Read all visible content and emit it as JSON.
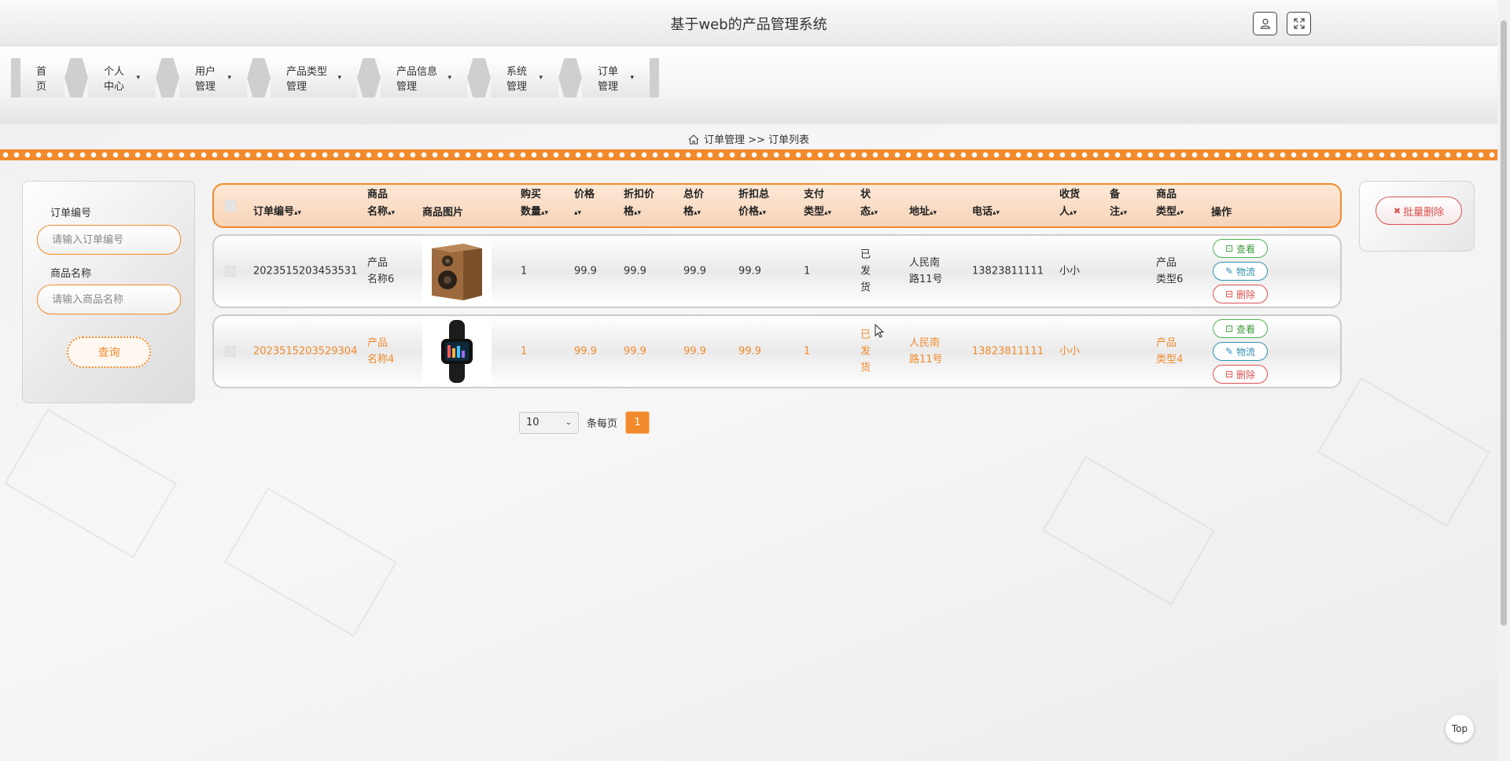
{
  "header": {
    "title": "基于web的产品管理系统",
    "icons": [
      "user-icon",
      "fullscreen-icon"
    ]
  },
  "nav": {
    "items": [
      {
        "label": "首页",
        "dropdown": false
      },
      {
        "label": "个人中心",
        "dropdown": true
      },
      {
        "label": "用户管理",
        "dropdown": true
      },
      {
        "label": "产品类型管理",
        "dropdown": true
      },
      {
        "label": "产品信息管理",
        "dropdown": true
      },
      {
        "label": "系统管理",
        "dropdown": true
      },
      {
        "label": "订单管理",
        "dropdown": true
      }
    ]
  },
  "breadcrumb": {
    "icon": "home-icon",
    "text": "订单管理 >> 订单列表"
  },
  "search": {
    "order_no_label": "订单编号",
    "order_no_placeholder": "请输入订单编号",
    "product_name_label": "商品名称",
    "product_name_placeholder": "请输入商品名称",
    "query_button": "查询"
  },
  "batch": {
    "delete_label": "批量删除"
  },
  "table": {
    "headers": [
      [
        "订单编号"
      ],
      [
        "商品",
        "名称"
      ],
      [
        "商品图片"
      ],
      [
        "购买",
        "数量"
      ],
      [
        "价格",
        ""
      ],
      [
        "折扣价",
        "格"
      ],
      [
        "总价",
        "格"
      ],
      [
        "折扣总",
        "价格"
      ],
      [
        "支付",
        "类型"
      ],
      [
        "状",
        "态"
      ],
      [
        "地址"
      ],
      [
        "电话"
      ],
      [
        "收货",
        "人"
      ],
      [
        "备",
        "注"
      ],
      [
        "商品",
        "类型"
      ],
      [
        "操作"
      ]
    ],
    "rows": [
      {
        "order_no": "2023515203453531",
        "product_name": [
          "产品",
          "名称6"
        ],
        "image": "speaker",
        "qty": "1",
        "price": "99.9",
        "discount_price": "99.9",
        "total": "99.9",
        "discount_total": "99.9",
        "pay_type": "1",
        "status": [
          "已",
          "发",
          "货"
        ],
        "address": [
          "人民南",
          "路11号"
        ],
        "phone": "13823811111",
        "receiver": "小小",
        "remark": "",
        "type": [
          "产品",
          "类型6"
        ],
        "highlighted": false
      },
      {
        "order_no": "2023515203529304",
        "product_name": [
          "产品",
          "名称4"
        ],
        "image": "smartwatch",
        "qty": "1",
        "price": "99.9",
        "discount_price": "99.9",
        "total": "99.9",
        "discount_total": "99.9",
        "pay_type": "1",
        "status": [
          "已",
          "发",
          "货"
        ],
        "address": [
          "人民南",
          "路11号"
        ],
        "phone": "13823811111",
        "receiver": "小小",
        "remark": "",
        "type": [
          "产品",
          "类型4"
        ],
        "highlighted": true
      }
    ],
    "actions": {
      "view": "查看",
      "logistics": "物流",
      "delete": "删除"
    }
  },
  "pagination": {
    "page_size": "10",
    "per_page_label": "条每页",
    "current_page": "1"
  },
  "top_button": "Top",
  "colors": {
    "accent": "#f08a2c",
    "view": "#3c9a3f",
    "logistics": "#2f8fb1",
    "delete": "#d9534f"
  }
}
